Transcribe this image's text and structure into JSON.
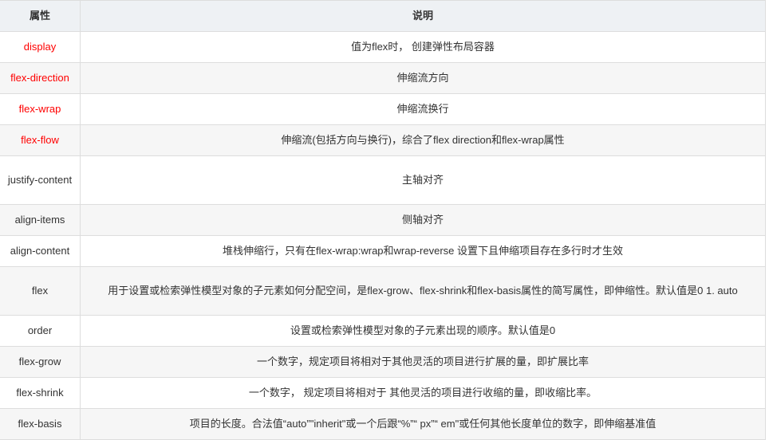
{
  "headers": {
    "property": "属性",
    "description": "说明"
  },
  "rows": [
    {
      "property": "display",
      "description": "值为flex时， 创建弹性布局容器",
      "highlight": true
    },
    {
      "property": "flex-direction",
      "description": "伸缩流方向",
      "highlight": true
    },
    {
      "property": "flex-wrap",
      "description": "伸缩流换行",
      "highlight": true
    },
    {
      "property": "flex-flow",
      "description": "伸缩流(包括方向与换行)，综合了flex direction和flex-wrap属性",
      "highlight": true
    },
    {
      "property": "justify-content",
      "description": "主轴对齐"
    },
    {
      "property": "align-items",
      "description": "侧轴对齐"
    },
    {
      "property": "align-content",
      "description": "堆栈伸缩行，只有在flex-wrap:wrap和wrap-reverse 设置下且伸缩项目存在多行时才生效"
    },
    {
      "property": "flex",
      "description": "用于设置或检索弹性模型对象的子元素如何分配空间，是flex-grow、flex-shrink和flex-basis属性的简写属性，即伸缩性。默认值是0 1. auto"
    },
    {
      "property": "order",
      "description": "设置或检索弹性模型对象的子元素出现的顺序。默认值是0"
    },
    {
      "property": "flex-grow",
      "description": "一个数字，规定项目将相对于其他灵活的项目进行扩展的量，即扩展比率"
    },
    {
      "property": "flex-shrink",
      "description": "一个数字， 规定项目将相对于 其他灵活的项目进行收缩的量，即收缩比率。"
    },
    {
      "property": "flex-basis",
      "description": "项目的长度。合法值“auto”\"inherit\"或一个后跟“%”“ px”“ em\"或任何其他长度单位的数字，即伸缩基准值"
    }
  ],
  "colors": {
    "highlight": "#ff0000",
    "header_bg": "#eef1f4",
    "stripe_bg": "#f6f6f6"
  }
}
